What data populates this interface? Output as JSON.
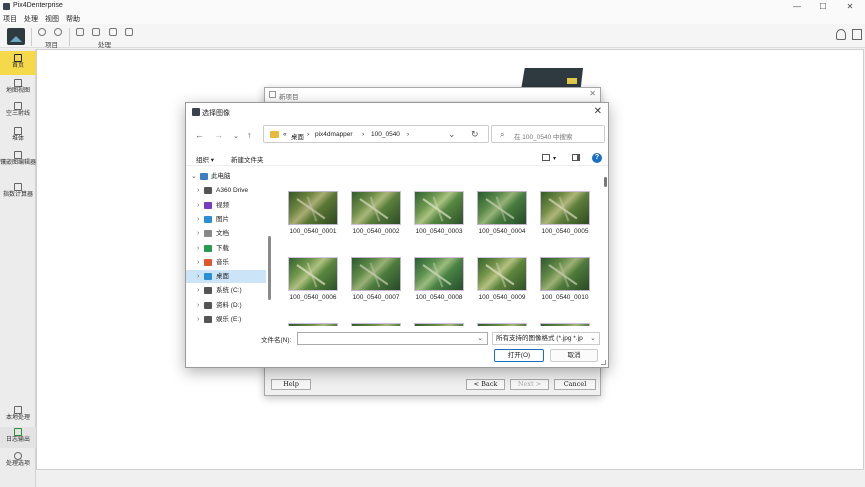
{
  "window": {
    "title": "Pix4Denterprise",
    "controls": [
      "—",
      "☐",
      "✕"
    ]
  },
  "menu": [
    "项目",
    "处理",
    "视图",
    "帮助"
  ],
  "toolbar": {
    "group1_label": "项目",
    "group2_label": "处理"
  },
  "sidebar": {
    "top": [
      {
        "label": "首页",
        "icon": "home-icon"
      },
      {
        "label": "地图视图",
        "icon": "map-icon"
      },
      {
        "label": "空三射线",
        "icon": "ray-icon"
      },
      {
        "label": "堆体",
        "icon": "volume-icon"
      },
      {
        "label": "镶嵌图编辑器",
        "icon": "mosaic-icon"
      },
      {
        "label": "指数计算器",
        "icon": "index-icon"
      }
    ],
    "bottom": [
      {
        "label": "本地处理",
        "icon": "local-icon"
      },
      {
        "label": "日志输出",
        "icon": "log-icon"
      },
      {
        "label": "处理选项",
        "icon": "gear-icon"
      }
    ]
  },
  "wizard": {
    "title": "新项目",
    "buttons": {
      "help": "Help",
      "back": "< Back",
      "next": "Next >",
      "cancel": "Cancel"
    }
  },
  "file_dialog": {
    "title": "选择图像",
    "breadcrumb": [
      "«",
      "桌面",
      "›",
      "pix4dmapper",
      "›",
      "100_0540",
      "›"
    ],
    "search_placeholder": "在 100_0540 中搜索",
    "organize": "组织 ▾",
    "new_folder": "新建文件夹",
    "tree": [
      {
        "label": "此电脑",
        "level": 0,
        "chev": "⌄",
        "color": "#3b7fc4"
      },
      {
        "label": "A360 Drive",
        "level": 1,
        "chev": "›",
        "color": "#555555"
      },
      {
        "label": "视频",
        "level": 1,
        "chev": "›",
        "color": "#7a3bc4"
      },
      {
        "label": "图片",
        "level": 1,
        "chev": "›",
        "color": "#2a8fd6"
      },
      {
        "label": "文档",
        "level": 1,
        "chev": "›",
        "color": "#888888"
      },
      {
        "label": "下载",
        "level": 1,
        "chev": "›",
        "color": "#2a9b4a"
      },
      {
        "label": "音乐",
        "level": 1,
        "chev": "›",
        "color": "#e0582c"
      },
      {
        "label": "桌面",
        "level": 1,
        "chev": "›",
        "color": "#2a8fd6",
        "selected": true
      },
      {
        "label": "系统 (C:)",
        "level": 1,
        "chev": "›",
        "color": "#555555"
      },
      {
        "label": "资料 (D:)",
        "level": 1,
        "chev": "›",
        "color": "#555555"
      },
      {
        "label": "娱乐 (E:)",
        "level": 1,
        "chev": "›",
        "color": "#555555"
      }
    ],
    "files": [
      "100_0540_0001",
      "100_0540_0002",
      "100_0540_0003",
      "100_0540_0004",
      "100_0540_0005",
      "100_0540_0006",
      "100_0540_0007",
      "100_0540_0008",
      "100_0540_0009",
      "100_0540_0010"
    ],
    "filename_label": "文件名(N):",
    "filename_value": "",
    "filetype": "所有支持的图像格式 (*.jpg *.jp",
    "open": "打开(O)",
    "cancel": "取消"
  }
}
